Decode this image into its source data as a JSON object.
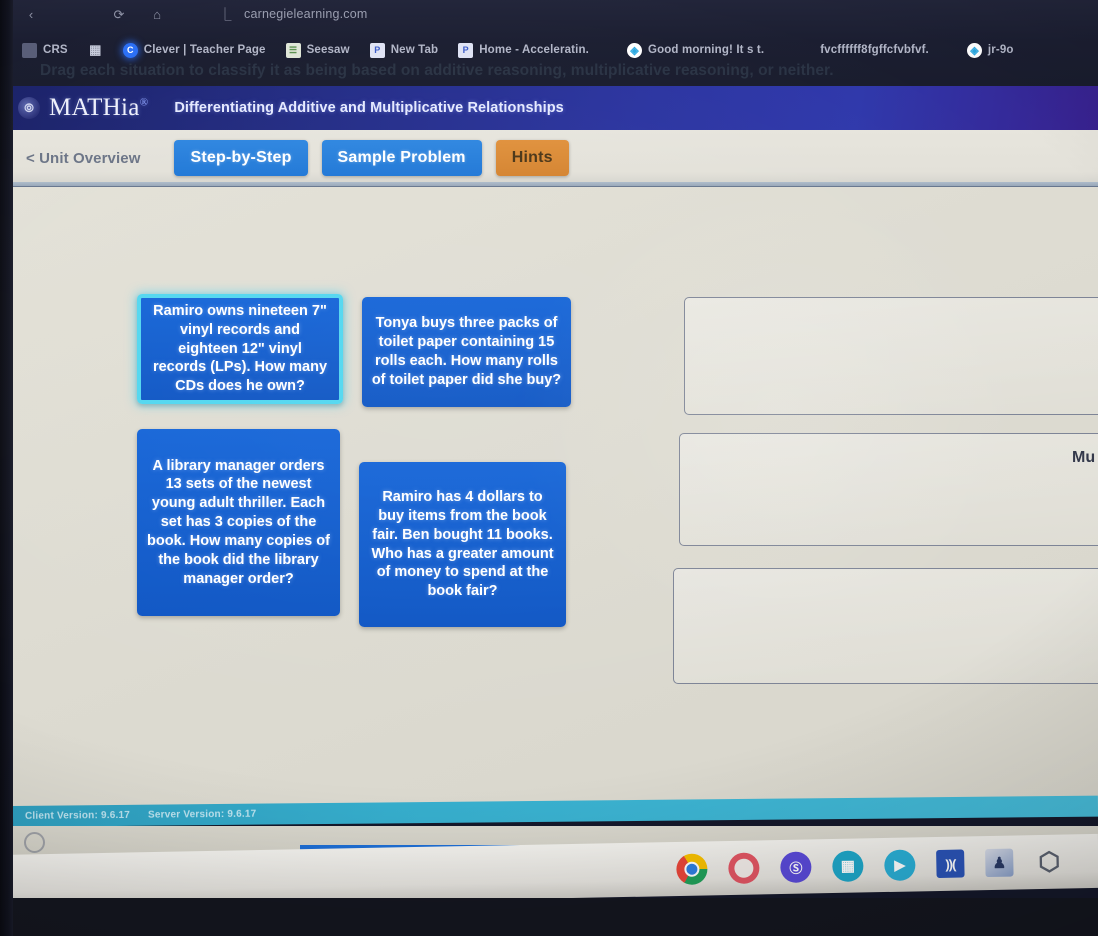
{
  "browser": {
    "url": "carnegielearning.com",
    "nav_icons": [
      {
        "name": "back-icon",
        "glyph": "‹"
      },
      {
        "name": "reload-icon",
        "glyph": "⟳"
      },
      {
        "name": "home-icon",
        "glyph": "⌂"
      },
      {
        "name": "lock-icon",
        "glyph": "⚿"
      }
    ],
    "bookmarks": [
      {
        "label": "CRS",
        "icon": "folder-icon"
      },
      {
        "label": "",
        "icon": "apps-grid-icon"
      },
      {
        "label": "Clever | Teacher Page",
        "icon": "clever-icon"
      },
      {
        "label": "Seesaw",
        "icon": "seesaw-icon"
      },
      {
        "label": "New Tab",
        "icon": "new-tab-icon"
      },
      {
        "label": "Home - Acceleratin.",
        "icon": "accelerate-icon"
      },
      {
        "label": "Good morning! It s t.",
        "icon": "doc-icon"
      },
      {
        "label": "fvcffffff8fgffcfvbfvf.",
        "icon": "none"
      },
      {
        "label": "jr-9o",
        "icon": "doc-icon"
      }
    ]
  },
  "app": {
    "logo_text": "MATHia",
    "logo_registered": "®",
    "subtitle": "Differentiating Additive and Multiplicative Relationships"
  },
  "tabs": {
    "unit_overview": "< Unit Overview",
    "items": [
      {
        "label": "Step-by-Step",
        "style": "blue"
      },
      {
        "label": "Sample Problem",
        "style": "blue"
      },
      {
        "label": "Hints",
        "style": "orange"
      }
    ]
  },
  "workspace": {
    "instruction": "Drag each situation to classify it as being based on additive reasoning, multiplicative reasoning, or neither.",
    "cards": [
      {
        "id": "card-1",
        "text": "Ramiro owns nineteen 7\" vinyl records and eighteen 12\" vinyl records (LPs). How many CDs does he own?",
        "selected": true
      },
      {
        "id": "card-2",
        "text": "Tonya buys three packs of toilet paper containing 15 rolls each. How many rolls of toilet paper did she buy?",
        "selected": false
      },
      {
        "id": "card-3",
        "text": "A library manager orders 13 sets of the newest young adult thriller. Each set has 3 copies of the book. How many copies of the book did the library manager order?",
        "selected": false
      },
      {
        "id": "card-4",
        "text": "Ramiro has 4 dollars to buy items from the book fair. Ben bought 11 books. Who has a greater amount of money to spend at the book fair?",
        "selected": false
      }
    ],
    "dropzones": [
      {
        "id": "zone-1",
        "label": "",
        "contents": []
      },
      {
        "id": "zone-2",
        "label": "Mu",
        "contents": []
      },
      {
        "id": "zone-3",
        "label": "",
        "contents": []
      }
    ]
  },
  "status_bar": {
    "client_version": "Client Version: 9.6.17",
    "server_version": "Server Version: 9.6.17"
  },
  "shelf": {
    "icons": [
      {
        "name": "chrome-icon",
        "glyph": ""
      },
      {
        "name": "app-red-icon",
        "glyph": ""
      },
      {
        "name": "seesaw-app-icon",
        "glyph": "S"
      },
      {
        "name": "presentation-app-icon",
        "glyph": "▣"
      },
      {
        "name": "zoom-app-icon",
        "glyph": "■"
      },
      {
        "name": "audio-app-icon",
        "glyph": ")) ("
      },
      {
        "name": "art-app-icon",
        "glyph": "♟"
      },
      {
        "name": "shield-icon",
        "glyph": "⬡"
      }
    ]
  },
  "colors": {
    "brand_header": "#2b34a0",
    "tab_blue": "#1f77d6",
    "tab_orange": "#d4832f",
    "card_blue": "#1565d8",
    "card_selected_border": "#51d7f0",
    "status_bar_teal": "#3fb6d4",
    "workspace_bg": "#dedcd2"
  }
}
